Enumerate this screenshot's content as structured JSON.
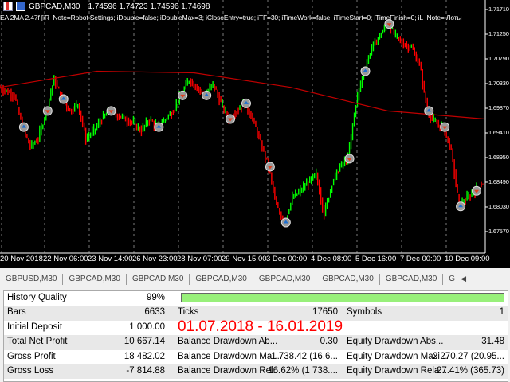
{
  "chart": {
    "symbol": "GBPCAD,M30",
    "ohlc": "1.74596 1.74723 1.74596 1.74698",
    "ea_line": "EA 2MA 2.47f [iR_Note=Robot Settings; iDouble=false; iDoubleMax=3; iCloseEntry=true; iTF=30; iTimeWork=false; iTimeStart=0; iTimeFinish=0; iL_Note= Лоты",
    "price_labels": [
      "1.71710",
      "1.71250",
      "1.70790",
      "1.70330",
      "1.69870",
      "1.69410",
      "1.68950",
      "1.68490",
      "1.68030",
      "1.67570"
    ],
    "time_labels": [
      "20 Nov 2018",
      "22 Nov 06:00",
      "23 Nov 14:00",
      "26 Nov 23:00",
      "28 Nov 07:00",
      "29 Nov 15:00",
      "3 Dec 00:00",
      "4 Dec 08:00",
      "5 Dec 16:00",
      "7 Dec 00:00",
      "10 Dec 09:00"
    ],
    "colors": {
      "bull": "#00ff00",
      "bear": "#ff0000",
      "ma": "#c00000",
      "bg": "#000000"
    }
  },
  "chart_data": {
    "type": "line",
    "title": "GBPCAD,M30",
    "ylim": [
      1.6725,
      1.719
    ],
    "close": [
      1.7026,
      1.7019,
      1.7011,
      1.6952,
      1.6915,
      1.693,
      1.6982,
      1.7041,
      1.7004,
      1.6982,
      1.6996,
      1.693,
      1.6945,
      1.6967,
      1.6982,
      1.6974,
      1.6967,
      1.6959,
      1.6945,
      1.6967,
      1.6952,
      1.6967,
      1.6982,
      1.7011,
      1.7041,
      1.7026,
      1.7011,
      1.7033,
      1.6996,
      1.6967,
      1.6982,
      1.6996,
      1.6967,
      1.6922,
      1.6878,
      1.6804,
      1.6774,
      1.6819,
      1.6833,
      1.6848,
      1.6863,
      1.6789,
      1.6848,
      1.6878,
      1.6893,
      1.6996,
      1.7056,
      1.71,
      1.7122,
      1.7144,
      1.7122,
      1.7107,
      1.71,
      1.707,
      1.6982,
      1.6959,
      1.6952,
      1.6908,
      1.6804,
      1.6819,
      1.6833,
      1.6848
    ],
    "ma": [
      1.7026,
      1.7056,
      1.7053,
      1.7026,
      1.6982,
      1.6967
    ]
  },
  "tabs": [
    "GBPUSD,M30",
    "GBPCAD,M30",
    "GBPCAD,M30",
    "GBPCAD,M30",
    "GBPCAD,M30",
    "GBPCAD,M30",
    "GBPCAD,M30",
    "G"
  ],
  "stats": {
    "history_quality_label": "History Quality",
    "history_quality": "99%",
    "history_quality_fraction": 0.99,
    "bars_label": "Bars",
    "bars": "6633",
    "ticks_label": "Ticks",
    "ticks": "17650",
    "symbols_label": "Symbols",
    "symbols": "1",
    "initial_deposit_label": "Initial Deposit",
    "initial_deposit": "1 000.00",
    "period": "01.07.2018 - 16.01.2019",
    "net_profit_label": "Total Net Profit",
    "net_profit": "10 667.14",
    "bal_dd_abs_label": "Balance Drawdown Ab...",
    "bal_dd_abs": "0.30",
    "eq_dd_abs_label": "Equity Drawdown Abs...",
    "eq_dd_abs": "31.48",
    "gross_profit_label": "Gross Profit",
    "gross_profit": "18 482.02",
    "bal_dd_max_label": "Balance Drawdown Ma...",
    "bal_dd_max": "1 738.42 (16.6...",
    "eq_dd_max_label": "Equity Drawdown Maxi...",
    "eq_dd_max": "2 270.27 (20.95...",
    "gross_loss_label": "Gross Loss",
    "gross_loss": "-7 814.88",
    "bal_dd_rel_label": "Balance Drawdown Rel...",
    "bal_dd_rel": "16.62% (1 738....",
    "eq_dd_rel_label": "Equity Drawdown Rela...",
    "eq_dd_rel": "27.41% (365.73)"
  }
}
